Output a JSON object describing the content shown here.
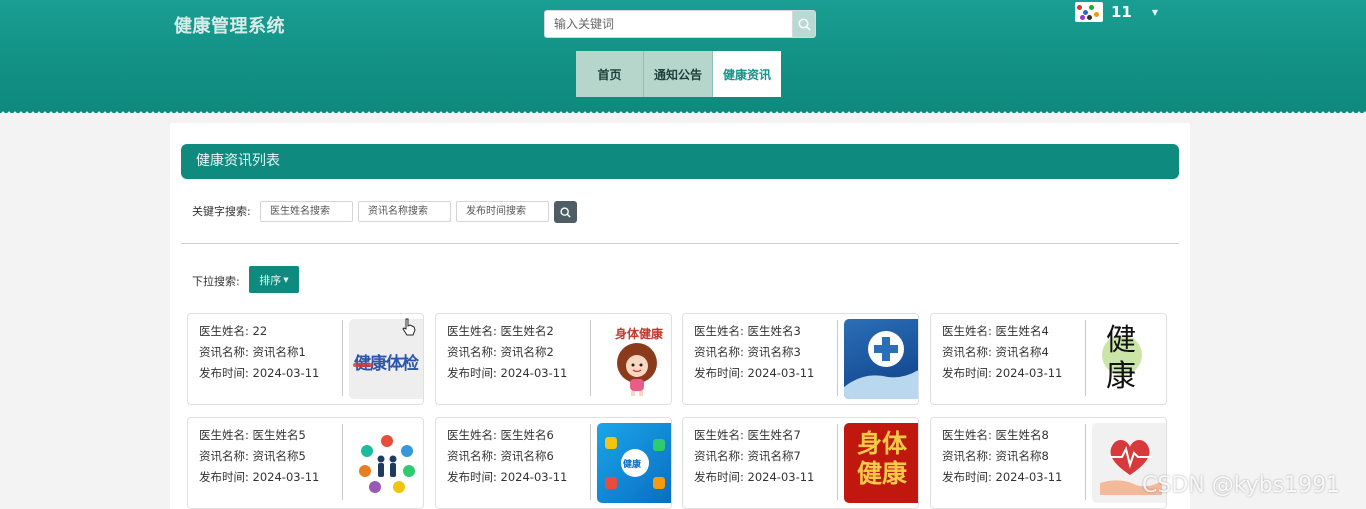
{
  "header": {
    "brand": "健康管理系统",
    "search_placeholder": "输入关键词",
    "username": "11"
  },
  "nav": [
    {
      "label": "首页",
      "active": false
    },
    {
      "label": "通知公告",
      "active": false
    },
    {
      "label": "健康资讯",
      "active": true
    }
  ],
  "list": {
    "title": "健康资讯列表",
    "keyword_label": "关键字搜索:",
    "doctor_placeholder": "医生姓名搜索",
    "info_placeholder": "资讯名称搜索",
    "time_placeholder": "发布时间搜索",
    "dropdown_label": "下拉搜索:",
    "sort_label": "排序"
  },
  "cards": [
    {
      "doctor": "医生姓名: 22",
      "name": "资讯名称: 资讯名称1",
      "time": "发布时间: 2024-03-11",
      "image_text": "健康体检"
    },
    {
      "doctor": "医生姓名: 医生姓名2",
      "name": "资讯名称: 资讯名称2",
      "time": "发布时间: 2024-03-11",
      "image_text": "身体健康"
    },
    {
      "doctor": "医生姓名: 医生姓名3",
      "name": "资讯名称: 资讯名称3",
      "time": "发布时间: 2024-03-11",
      "image_text": ""
    },
    {
      "doctor": "医生姓名: 医生姓名4",
      "name": "资讯名称: 资讯名称4",
      "time": "发布时间: 2024-03-11",
      "image_text": "健康"
    },
    {
      "doctor": "医生姓名: 医生姓名5",
      "name": "资讯名称: 资讯名称5",
      "time": "发布时间: 2024-03-11",
      "image_text": ""
    },
    {
      "doctor": "医生姓名: 医生姓名6",
      "name": "资讯名称: 资讯名称6",
      "time": "发布时间: 2024-03-11",
      "image_text": "健康"
    },
    {
      "doctor": "医生姓名: 医生姓名7",
      "name": "资讯名称: 资讯名称7",
      "time": "发布时间: 2024-03-11",
      "image_text": "身体健康"
    },
    {
      "doctor": "医生姓名: 医生姓名8",
      "name": "资讯名称: 资讯名称8",
      "time": "发布时间: 2024-03-11",
      "image_text": ""
    }
  ],
  "watermark": "CSDN @kybs1991",
  "colors": {
    "primary": "#0f8a7e",
    "nav_bg": "#b6d6cc"
  }
}
